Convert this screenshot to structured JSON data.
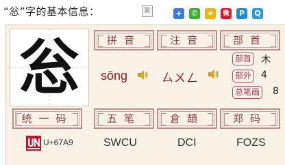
{
  "header": {
    "title": "“忩”字的基本信息：",
    "icon_name": "traditional-character-icon",
    "icon_glyph": "繁"
  },
  "share": [
    {
      "name": "add-share",
      "glyph": "+",
      "color": "#3a7bd5"
    },
    {
      "name": "wechat-share",
      "glyph": "✆",
      "color": "#3cb034"
    },
    {
      "name": "qzone-share",
      "glyph": "★",
      "color": "#f0b400"
    },
    {
      "name": "weibo-share",
      "glyph": "微",
      "color": "#e6162d"
    },
    {
      "name": "paypal-share",
      "glyph": "P",
      "color": "#1a8fd8"
    },
    {
      "name": "pocket-share",
      "glyph": "Q",
      "color": "#2b9ad6"
    }
  ],
  "character": "忩",
  "labels": {
    "pinyin": "拼音",
    "zhuyin": "注音",
    "radical_header": "部首",
    "unicode": "统一码",
    "wubi": "五笔",
    "cangjie": "倉頡",
    "zhengma": "郑码"
  },
  "pinyin": "sōng",
  "zhuyin": "ㄙㄨㄥ",
  "radical_info": {
    "radical_tag": "部首",
    "radical_value": "木",
    "strokes_outside_tag": "部外",
    "strokes_outside_value": "4",
    "total_strokes_tag": "总笔画",
    "total_strokes_value": "8"
  },
  "codes": {
    "unicode": "U+67A9",
    "wubi": "SWCU",
    "cangjie": "DCI",
    "zhengma": "FOZS"
  },
  "colors": {
    "panel_bg": "#f7f1e6",
    "label_text": "#8f3e3e",
    "accent_red": "#8b1a1a"
  }
}
